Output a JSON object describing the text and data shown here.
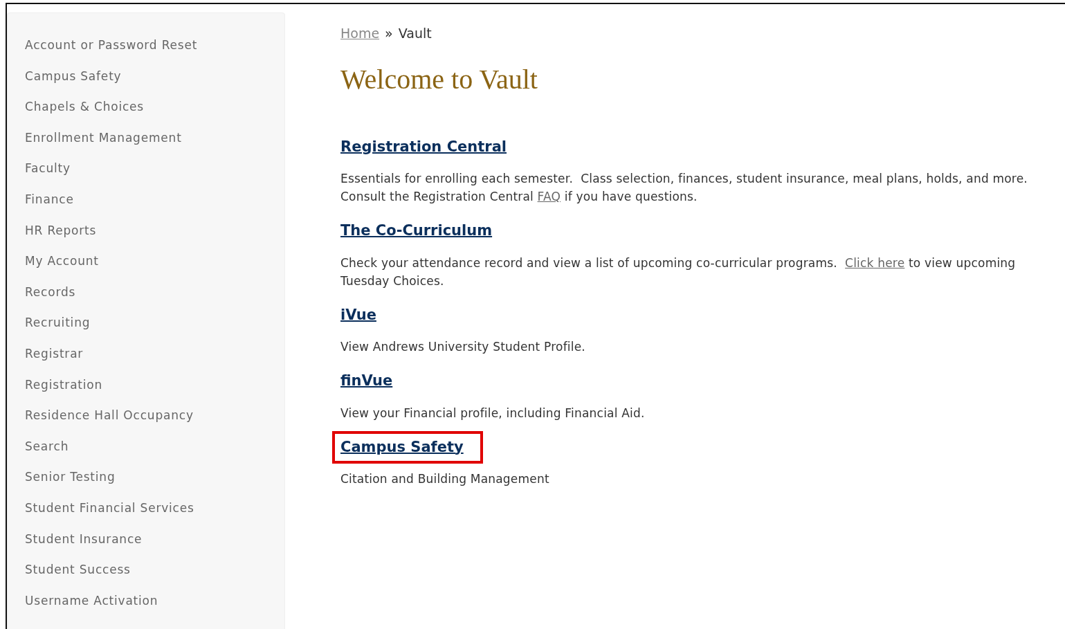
{
  "sidebar": {
    "items": [
      {
        "label": "Account or Password Reset"
      },
      {
        "label": "Campus Safety"
      },
      {
        "label": "Chapels & Choices"
      },
      {
        "label": "Enrollment Management"
      },
      {
        "label": "Faculty"
      },
      {
        "label": "Finance"
      },
      {
        "label": "HR Reports"
      },
      {
        "label": "My Account"
      },
      {
        "label": "Records"
      },
      {
        "label": "Recruiting"
      },
      {
        "label": "Registrar"
      },
      {
        "label": "Registration"
      },
      {
        "label": "Residence Hall Occupancy"
      },
      {
        "label": "Search"
      },
      {
        "label": "Senior Testing"
      },
      {
        "label": "Student Financial Services"
      },
      {
        "label": "Student Insurance"
      },
      {
        "label": "Student Success"
      },
      {
        "label": "Username Activation"
      }
    ]
  },
  "breadcrumb": {
    "link": "Home",
    "separator": "»",
    "current": "Vault"
  },
  "heading": "Welcome to Vault",
  "sections": [
    {
      "title": "Registration Central",
      "highlighted": false,
      "description": [
        {
          "kind": "text",
          "text": "Essentials for enrolling each semester.  Class selection, finances, student insurance, meal plans, holds, and more.  Consult the Registration Central "
        },
        {
          "kind": "link",
          "text": "FAQ"
        },
        {
          "kind": "text",
          "text": " if you have questions."
        }
      ]
    },
    {
      "title": "The Co-Curriculum",
      "highlighted": false,
      "description": [
        {
          "kind": "text",
          "text": "Check your attendance record and view a list of upcoming co-curricular programs.  "
        },
        {
          "kind": "link",
          "text": "Click here"
        },
        {
          "kind": "text",
          "text": " to view upcoming Tuesday Choices."
        }
      ]
    },
    {
      "title": "iVue",
      "highlighted": false,
      "description": [
        {
          "kind": "text",
          "text": "View Andrews University Student Profile."
        }
      ]
    },
    {
      "title": "finVue",
      "highlighted": false,
      "description": [
        {
          "kind": "text",
          "text": "View your Financial profile, including Financial Aid."
        }
      ]
    },
    {
      "title": "Campus Safety",
      "highlighted": true,
      "description": [
        {
          "kind": "text",
          "text": "Citation and Building Management"
        }
      ]
    }
  ]
}
